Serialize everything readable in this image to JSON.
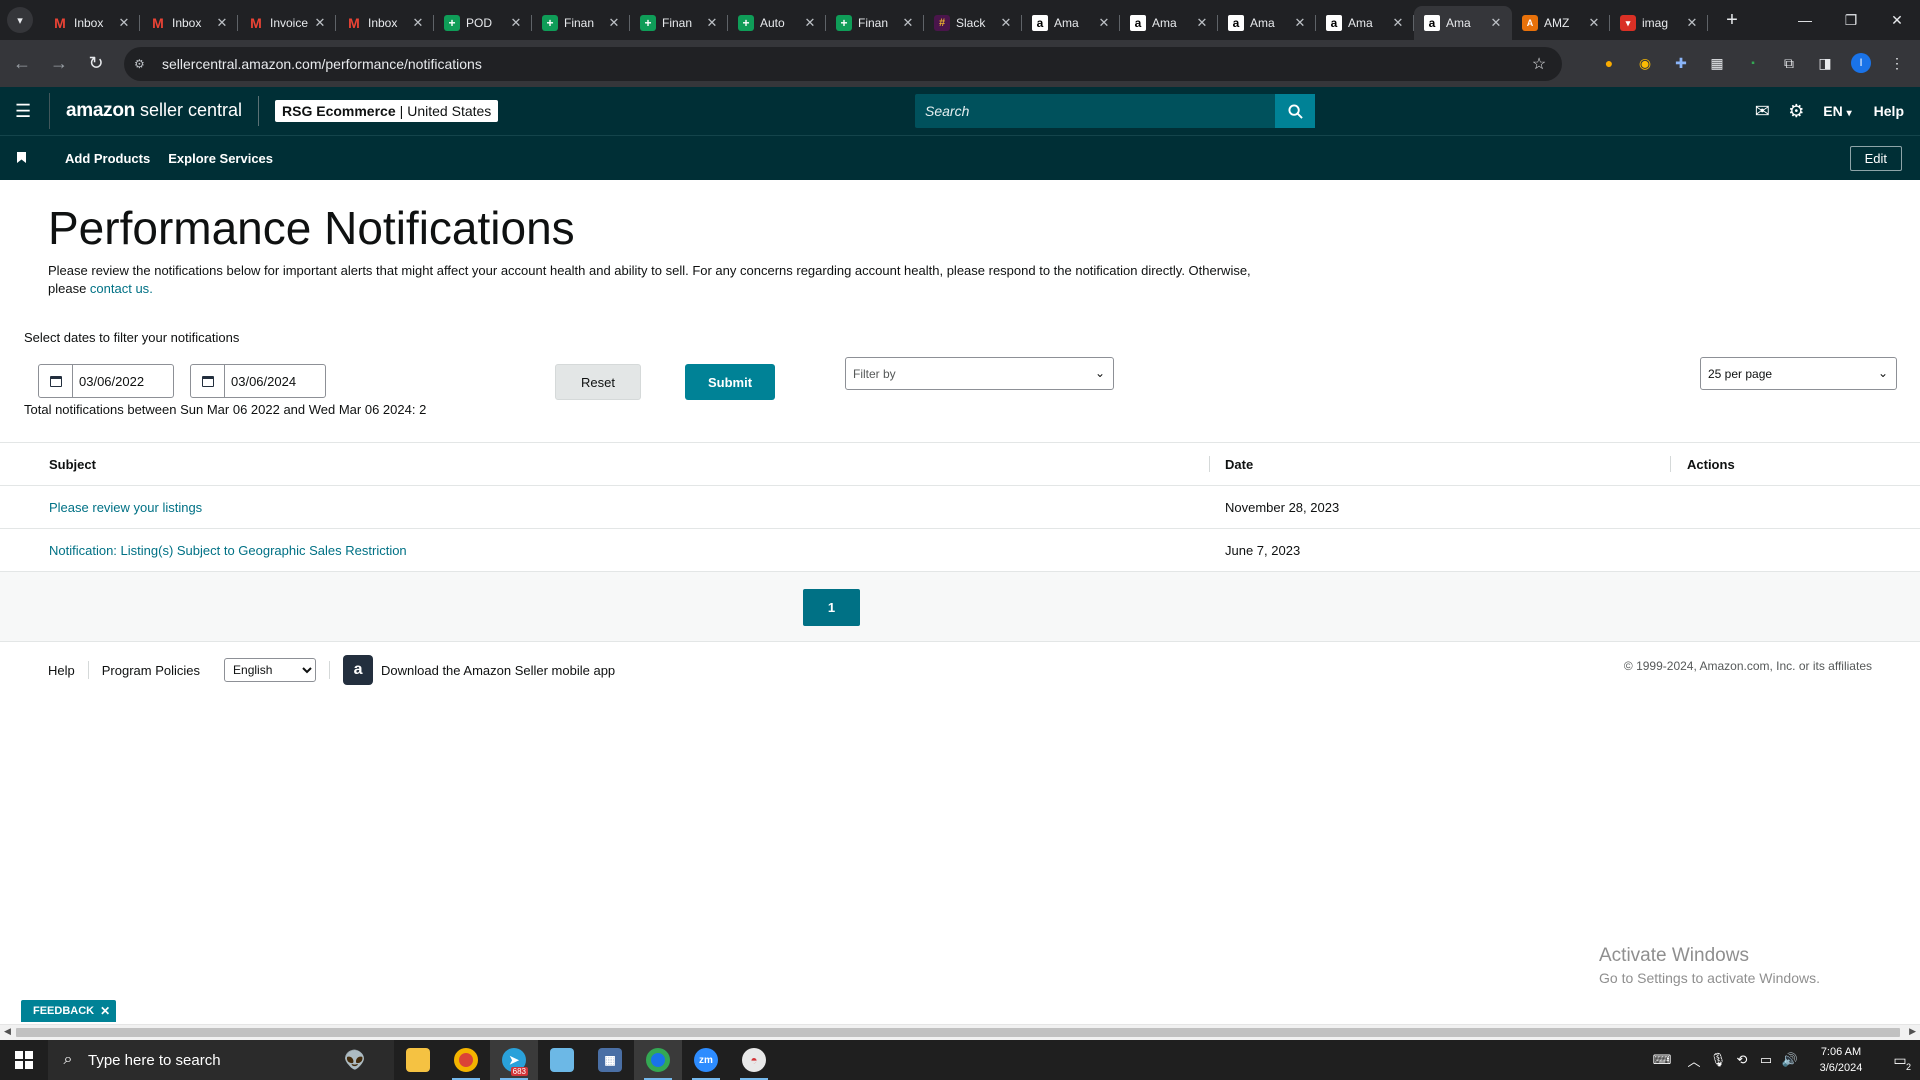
{
  "browser": {
    "tabs": [
      {
        "title": "Inbox",
        "icon": "gmail-icon"
      },
      {
        "title": "Inbox",
        "icon": "gmail-icon"
      },
      {
        "title": "Invoice",
        "icon": "gmail-icon"
      },
      {
        "title": "Inbox",
        "icon": "gmail-icon"
      },
      {
        "title": "POD",
        "icon": "sheets-icon"
      },
      {
        "title": "Finan",
        "icon": "sheets-icon"
      },
      {
        "title": "Finan",
        "icon": "sheets-icon"
      },
      {
        "title": "Auto",
        "icon": "sheets-icon"
      },
      {
        "title": "Finan",
        "icon": "sheets-icon"
      },
      {
        "title": "Slack",
        "icon": "slack-icon"
      },
      {
        "title": "Ama",
        "icon": "amazon-icon"
      },
      {
        "title": "Ama",
        "icon": "amazon-icon"
      },
      {
        "title": "Ama",
        "icon": "amazon-icon"
      },
      {
        "title": "Ama",
        "icon": "amazon-icon"
      },
      {
        "title": "Ama",
        "icon": "amazon-icon"
      },
      {
        "title": "AMZ",
        "icon": "amz-icon"
      },
      {
        "title": "imag",
        "icon": "image-icon"
      }
    ],
    "active_tab_index": 14,
    "url": "sellercentral.amazon.com/performance/notifications",
    "profile_initial": "I"
  },
  "header": {
    "logo_amazon": "amazon",
    "logo_suffix": "seller central",
    "store_name": "RSG Ecommerce",
    "store_region": "United States",
    "search_placeholder": "Search",
    "language": "EN",
    "help": "Help"
  },
  "nav": {
    "links": [
      "Add Products",
      "Explore Services"
    ],
    "edit": "Edit"
  },
  "page": {
    "title": "Performance Notifications",
    "intro_text": "Please review the notifications below for important alerts that might affect your account health and ability to sell. For any concerns regarding account health, please respond to the notification directly. Otherwise, please ",
    "intro_link": "contact us",
    "intro_end": "."
  },
  "filters": {
    "label": "Select dates to filter your notifications",
    "start_date": "03/06/2022",
    "end_date": "03/06/2024",
    "total": "Total notifications between Sun Mar 06 2022 and Wed Mar 06 2024: 2",
    "reset": "Reset",
    "submit": "Submit",
    "filter_placeholder": "Filter by",
    "per_page": "25 per page"
  },
  "table": {
    "headers": {
      "subject": "Subject",
      "date": "Date",
      "actions": "Actions"
    },
    "rows": [
      {
        "subject": "Please review your listings",
        "date": "November 28, 2023"
      },
      {
        "subject": "Notification: Listing(s) Subject to Geographic Sales Restriction",
        "date": "June 7, 2023"
      }
    ]
  },
  "pagination": {
    "current_page": "1"
  },
  "footer": {
    "help": "Help",
    "program_policies": "Program Policies",
    "language_option": "English",
    "app_text": "Download the Amazon Seller mobile app",
    "copyright": "© 1999-2024, Amazon.com, Inc. or its affiliates"
  },
  "watermark": {
    "title": "Activate Windows",
    "subtitle": "Go to Settings to activate Windows."
  },
  "feedback": {
    "label": "FEEDBACK"
  },
  "taskbar": {
    "search_placeholder": "Type here to search",
    "telegram_badge": "683",
    "time": "7:06 AM",
    "date": "3/6/2024",
    "notification_count": "2"
  },
  "colors": {
    "header_bg": "#002f36",
    "accent": "#008296",
    "link": "#007185"
  }
}
